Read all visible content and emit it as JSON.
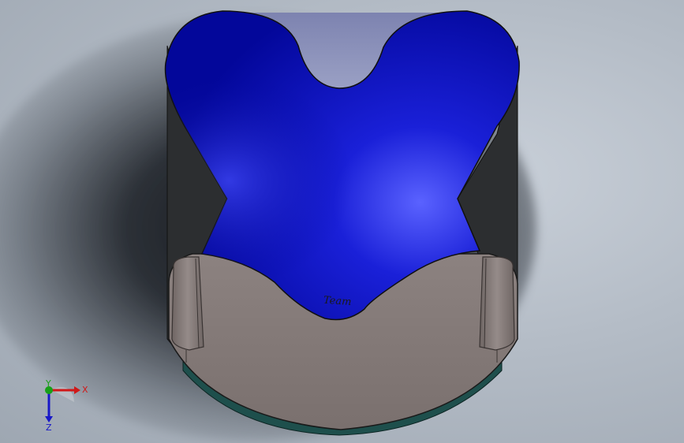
{
  "app": {
    "view_name": ""
  },
  "model": {
    "engraved_text": "Team",
    "colors": {
      "background": "#b4bcc6",
      "body_blue": "#0a0fbf",
      "body_blue_dark": "#03079a",
      "body_highlight": "#4a52ff",
      "base_brown": "#837876",
      "base_brown_light": "#8e8482",
      "side_wall_dark": "#2c2e30",
      "teal_rim": "#1e4f4c",
      "back_panel": "#8a8fb8"
    }
  },
  "triad": {
    "x_label": "X",
    "y_label": "Y",
    "z_label": "Z",
    "colors": {
      "x": "#d01818",
      "y": "#18a018",
      "z": "#1818c8"
    }
  }
}
